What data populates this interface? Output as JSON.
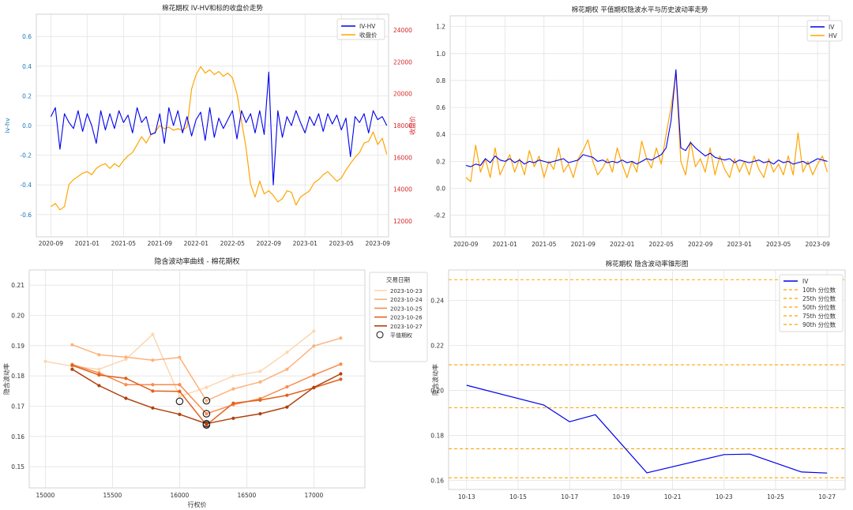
{
  "chart_data": [
    {
      "type": "line",
      "title": "棉花期权 IV-HV和标的收盘价走势",
      "xlabel": "",
      "ylabel": "iv-hv",
      "ylabel_right": "收盘价",
      "x_ticks": [
        "2020-09",
        "2021-01",
        "2021-05",
        "2021-09",
        "2022-01",
        "2022-05",
        "2022-09",
        "2023-01",
        "2023-05",
        "2023-09"
      ],
      "ylim": [
        -0.75,
        0.75
      ],
      "y_ticks": [
        -0.6,
        -0.4,
        -0.2,
        0.0,
        0.2,
        0.4,
        0.6
      ],
      "ylim_right": [
        11000,
        25000
      ],
      "y_ticks_right": [
        12000,
        14000,
        16000,
        18000,
        20000,
        22000,
        24000
      ],
      "xlim_months": [
        -1.6,
        37.2
      ],
      "grid": true,
      "legend_position": "upper-right",
      "series": [
        {
          "name": "IV-HV",
          "axis": "left",
          "color": "#0000ee",
          "x": [
            0,
            0.5,
            1,
            1.5,
            2,
            2.5,
            3,
            3.5,
            4,
            4.5,
            5,
            5.5,
            6,
            6.5,
            7,
            7.5,
            8,
            8.5,
            9,
            9.5,
            10,
            10.5,
            11,
            11.5,
            12,
            12.5,
            13,
            13.5,
            14,
            14.5,
            15,
            15.5,
            16,
            16.5,
            17,
            17.5,
            18,
            18.5,
            19,
            19.5,
            20,
            20.5,
            21,
            21.5,
            22,
            22.5,
            23,
            23.5,
            24,
            24.5,
            25,
            25.5,
            26,
            26.5,
            27,
            27.5,
            28,
            28.5,
            29,
            29.5,
            30,
            30.5,
            31,
            31.5,
            32,
            32.5,
            33,
            33.5,
            34,
            34.5,
            35,
            35.5,
            36,
            36.5,
            37
          ],
          "y": [
            0.06,
            0.12,
            -0.16,
            0.08,
            0.02,
            -0.02,
            0.1,
            -0.04,
            0.08,
            0.0,
            -0.12,
            0.1,
            -0.03,
            0.08,
            -0.02,
            0.1,
            0.02,
            0.07,
            -0.05,
            0.12,
            0.02,
            0.06,
            -0.06,
            -0.05,
            0.08,
            -0.12,
            0.12,
            0.0,
            0.1,
            -0.05,
            0.06,
            -0.07,
            0.04,
            0.09,
            -0.1,
            0.12,
            -0.08,
            0.05,
            -0.02,
            0.04,
            0.1,
            -0.09,
            0.1,
            0.02,
            0.08,
            -0.05,
            0.1,
            -0.06,
            0.36,
            -0.4,
            0.1,
            -0.08,
            0.06,
            0.0,
            0.1,
            0.02,
            -0.05,
            0.06,
            0.0,
            0.08,
            -0.04,
            0.08,
            0.01,
            0.07,
            -0.03,
            0.05,
            -0.21,
            0.06,
            0.02,
            0.08,
            -0.05,
            0.1,
            0.04,
            0.06,
            0.0
          ]
        },
        {
          "name": "收盘价",
          "axis": "right",
          "color": "#ffa500",
          "x": [
            0,
            0.5,
            1,
            1.5,
            2,
            2.5,
            3,
            3.5,
            4,
            4.5,
            5,
            5.5,
            6,
            6.5,
            7,
            7.5,
            8,
            8.5,
            9,
            9.5,
            10,
            10.5,
            11,
            11.5,
            12,
            12.5,
            13,
            13.5,
            14,
            14.5,
            15,
            15.5,
            16,
            16.5,
            17,
            17.5,
            18,
            18.5,
            19,
            19.5,
            20,
            20.5,
            21,
            21.5,
            22,
            22.5,
            23,
            23.5,
            24,
            24.5,
            25,
            25.5,
            26,
            26.5,
            27,
            27.5,
            28,
            28.5,
            29,
            29.5,
            30,
            30.5,
            31,
            31.5,
            32,
            32.5,
            33,
            33.5,
            34,
            34.5,
            35,
            35.5,
            36,
            36.5,
            37
          ],
          "y": [
            12900,
            13100,
            12700,
            12900,
            14300,
            14600,
            14800,
            15000,
            15100,
            14900,
            15300,
            15500,
            15600,
            15300,
            15600,
            15400,
            15800,
            16100,
            16300,
            16800,
            17300,
            16900,
            17400,
            17600,
            18000,
            17800,
            17900,
            17700,
            17800,
            17700,
            17900,
            20300,
            21200,
            21700,
            21300,
            21500,
            21200,
            21400,
            21100,
            21300,
            21000,
            20000,
            18300,
            16600,
            14300,
            13500,
            14500,
            13700,
            13900,
            13600,
            13200,
            13400,
            13900,
            13800,
            13000,
            13500,
            13700,
            13900,
            14400,
            14600,
            14900,
            15100,
            14800,
            14500,
            14700,
            15200,
            15600,
            16000,
            16300,
            16900,
            17000,
            17600,
            16800,
            17200,
            16200
          ]
        }
      ]
    },
    {
      "type": "line",
      "title": "棉花期权 平值期权隐波水平与历史波动率走势",
      "xlabel": "",
      "ylabel": "",
      "x_ticks": [
        "2020-09",
        "2021-01",
        "2021-05",
        "2021-09",
        "2022-01",
        "2022-05",
        "2022-09",
        "2023-01",
        "2023-05",
        "2023-09"
      ],
      "ylim": [
        -0.36,
        1.28
      ],
      "y_ticks": [
        -0.2,
        0.0,
        0.2,
        0.4,
        0.6,
        0.8,
        1.0,
        1.2
      ],
      "xlim_months": [
        -1.6,
        37.2
      ],
      "grid": true,
      "legend_position": "upper-right",
      "series": [
        {
          "name": "IV",
          "color": "#0000ee",
          "x": [
            0,
            0.5,
            1,
            1.5,
            2,
            2.5,
            3,
            3.5,
            4,
            4.5,
            5,
            5.5,
            6,
            6.5,
            7,
            7.5,
            8,
            8.5,
            9,
            9.5,
            10,
            10.5,
            11,
            11.5,
            12,
            12.5,
            13,
            13.5,
            14,
            14.5,
            15,
            15.5,
            16,
            16.5,
            17,
            17.5,
            18,
            18.5,
            19,
            19.5,
            20,
            20.5,
            21,
            21.5,
            22,
            22.5,
            23,
            23.5,
            24,
            24.5,
            25,
            25.5,
            26,
            26.5,
            27,
            27.5,
            28,
            28.5,
            29,
            29.5,
            30,
            30.5,
            31,
            31.5,
            32,
            32.5,
            33,
            33.5,
            34,
            34.5,
            35,
            35.5,
            36,
            36.5,
            37
          ],
          "y": [
            0.17,
            0.16,
            0.18,
            0.17,
            0.22,
            0.19,
            0.24,
            0.21,
            0.2,
            0.22,
            0.19,
            0.21,
            0.18,
            0.2,
            0.19,
            0.21,
            0.2,
            0.19,
            0.2,
            0.21,
            0.22,
            0.19,
            0.2,
            0.21,
            0.25,
            0.24,
            0.23,
            0.2,
            0.21,
            0.19,
            0.2,
            0.19,
            0.21,
            0.19,
            0.2,
            0.18,
            0.2,
            0.22,
            0.21,
            0.23,
            0.25,
            0.3,
            0.5,
            0.88,
            0.3,
            0.28,
            0.34,
            0.3,
            0.27,
            0.24,
            0.26,
            0.23,
            0.22,
            0.21,
            0.22,
            0.19,
            0.21,
            0.2,
            0.19,
            0.2,
            0.21,
            0.19,
            0.2,
            0.18,
            0.21,
            0.19,
            0.2,
            0.18,
            0.19,
            0.2,
            0.18,
            0.2,
            0.22,
            0.21,
            0.2
          ]
        },
        {
          "name": "HV",
          "color": "#ffa500",
          "x": [
            0,
            0.5,
            1,
            1.5,
            2,
            2.5,
            3,
            3.5,
            4,
            4.5,
            5,
            5.5,
            6,
            6.5,
            7,
            7.5,
            8,
            8.5,
            9,
            9.5,
            10,
            10.5,
            11,
            11.5,
            12,
            12.5,
            13,
            13.5,
            14,
            14.5,
            15,
            15.5,
            16,
            16.5,
            17,
            17.5,
            18,
            18.5,
            19,
            19.5,
            20,
            20.5,
            21,
            21.5,
            22,
            22.5,
            23,
            23.5,
            24,
            24.5,
            25,
            25.5,
            26,
            26.5,
            27,
            27.5,
            28,
            28.5,
            29,
            29.5,
            30,
            30.5,
            31,
            31.5,
            32,
            32.5,
            33,
            33.5,
            34,
            34.5,
            35,
            35.5,
            36,
            36.5,
            37
          ],
          "y": [
            0.08,
            0.05,
            0.32,
            0.12,
            0.22,
            0.08,
            0.3,
            0.1,
            0.18,
            0.25,
            0.12,
            0.22,
            0.1,
            0.28,
            0.16,
            0.24,
            0.08,
            0.2,
            0.14,
            0.3,
            0.12,
            0.18,
            0.08,
            0.22,
            0.28,
            0.36,
            0.2,
            0.1,
            0.15,
            0.22,
            0.12,
            0.3,
            0.18,
            0.08,
            0.2,
            0.12,
            0.35,
            0.22,
            0.15,
            0.3,
            0.18,
            0.4,
            0.6,
            0.85,
            0.2,
            0.1,
            0.35,
            0.16,
            0.22,
            0.12,
            0.3,
            0.1,
            0.24,
            0.14,
            0.08,
            0.22,
            0.12,
            0.2,
            0.1,
            0.24,
            0.14,
            0.08,
            0.22,
            0.12,
            0.18,
            0.1,
            0.24,
            0.1,
            0.41,
            0.12,
            0.2,
            0.1,
            0.18,
            0.24,
            0.12
          ]
        }
      ]
    },
    {
      "type": "line",
      "title": "隐含波动率曲线 - 棉花期权",
      "xlabel": "行权价",
      "ylabel": "隐含波动率",
      "legend_title": "交易日期",
      "legend_position": "upper-right",
      "xlim": [
        14880,
        17380
      ],
      "ylim": [
        0.143,
        0.215
      ],
      "x_ticks": [
        15000,
        15500,
        16000,
        16500,
        17000
      ],
      "y_ticks": [
        0.15,
        0.16,
        0.17,
        0.18,
        0.19,
        0.2,
        0.21
      ],
      "grid": true,
      "series": [
        {
          "name": "2023-10-23",
          "color": "#fdd7b0",
          "x": [
            15000,
            15200,
            15400,
            15600,
            15800,
            16000,
            16200,
            16400,
            16600,
            16800,
            17000
          ],
          "y": [
            0.1848,
            0.1832,
            0.1822,
            0.1855,
            0.1937,
            0.1732,
            0.1762,
            0.18,
            0.1815,
            0.1878,
            0.1948
          ]
        },
        {
          "name": "2023-10-24",
          "color": "#fdb27a",
          "x": [
            15200,
            15400,
            15600,
            15800,
            16000,
            16200,
            16400,
            16600,
            16800,
            17000,
            17200
          ],
          "y": [
            0.1903,
            0.187,
            0.1862,
            0.1852,
            0.1861,
            0.1718,
            0.1757,
            0.178,
            0.1822,
            0.1899,
            0.1925
          ]
        },
        {
          "name": "2023-10-25",
          "color": "#f98b4a",
          "x": [
            15200,
            15400,
            15600,
            15800,
            16000,
            16200,
            16400,
            16600,
            16800,
            17000,
            17200
          ],
          "y": [
            0.1838,
            0.181,
            0.1771,
            0.1771,
            0.1771,
            0.1675,
            0.1705,
            0.1725,
            0.1764,
            0.1803,
            0.1839
          ]
        },
        {
          "name": "2023-10-26",
          "color": "#e0611e",
          "x": [
            15200,
            15400,
            15600,
            15800,
            16000,
            16200,
            16400,
            16600,
            16800,
            17000,
            17200
          ],
          "y": [
            0.1835,
            0.1803,
            0.1792,
            0.175,
            0.1749,
            0.1638,
            0.171,
            0.172,
            0.1736,
            0.1761,
            0.1789
          ]
        },
        {
          "name": "2023-10-27",
          "color": "#b0410e",
          "x": [
            15200,
            15400,
            15600,
            15800,
            16000,
            16200,
            16400,
            16600,
            16800,
            17000,
            17200
          ],
          "y": [
            0.1822,
            0.1768,
            0.1726,
            0.1694,
            0.1673,
            0.1642,
            0.166,
            0.1675,
            0.1697,
            0.1762,
            0.1807
          ]
        }
      ],
      "atm_points": {
        "name": "平值期权",
        "x": [
          16000,
          16200,
          16200,
          16200,
          16200
        ],
        "y": [
          0.1716,
          0.1718,
          0.1675,
          0.1638,
          0.1642
        ]
      }
    },
    {
      "type": "line",
      "title": "棉花期权 隐含波动率锥形图",
      "xlabel": "",
      "ylabel": "隐含波动率",
      "legend_position": "upper-right",
      "x_ticks": [
        "10-13",
        "10-15",
        "10-17",
        "10-19",
        "10-21",
        "10-23",
        "10-25",
        "10-27"
      ],
      "x_tick_days": [
        13,
        15,
        17,
        19,
        21,
        23,
        25,
        27
      ],
      "xlim": [
        12.3,
        27.7
      ],
      "ylim": [
        0.156,
        0.2535
      ],
      "y_ticks": [
        0.16,
        0.18,
        0.2,
        0.22,
        0.24
      ],
      "grid": true,
      "series": [
        {
          "name": "IV",
          "color": "#0000ee",
          "x": [
            13,
            16,
            17,
            18,
            20,
            23,
            24,
            26,
            27
          ],
          "y": [
            0.2023,
            0.1935,
            0.1861,
            0.1892,
            0.1634,
            0.1715,
            0.1717,
            0.1638,
            0.1633
          ]
        }
      ],
      "hlines": [
        {
          "name": "10th 分位数",
          "value": 0.1612,
          "color": "#ffa500"
        },
        {
          "name": "25th 分位数",
          "value": 0.1741,
          "color": "#ffa500"
        },
        {
          "name": "50th 分位数",
          "value": 0.1923,
          "color": "#ffa500"
        },
        {
          "name": "75th 分位数",
          "value": 0.2114,
          "color": "#ffa500"
        },
        {
          "name": "90th 分位数",
          "value": 0.2492,
          "color": "#ffa500"
        }
      ]
    }
  ]
}
